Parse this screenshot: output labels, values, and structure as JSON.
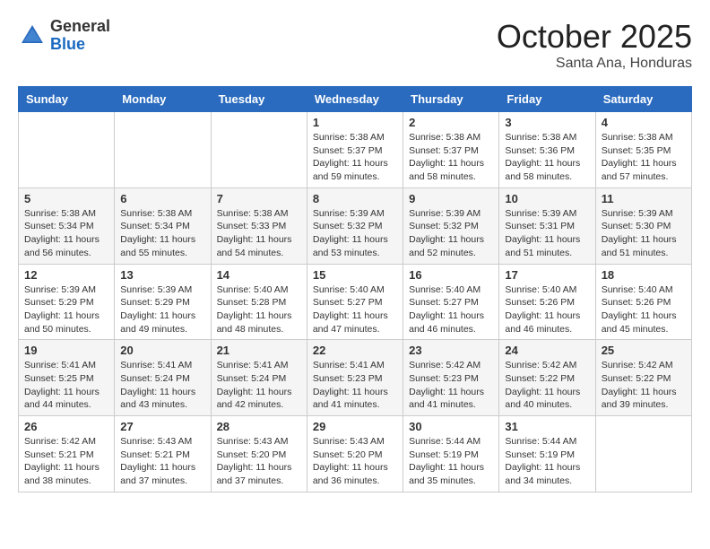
{
  "header": {
    "logo_general": "General",
    "logo_blue": "Blue",
    "month_title": "October 2025",
    "subtitle": "Santa Ana, Honduras"
  },
  "days_of_week": [
    "Sunday",
    "Monday",
    "Tuesday",
    "Wednesday",
    "Thursday",
    "Friday",
    "Saturday"
  ],
  "weeks": [
    [
      {
        "day": "",
        "info": ""
      },
      {
        "day": "",
        "info": ""
      },
      {
        "day": "",
        "info": ""
      },
      {
        "day": "1",
        "info": "Sunrise: 5:38 AM\nSunset: 5:37 PM\nDaylight: 11 hours\nand 59 minutes."
      },
      {
        "day": "2",
        "info": "Sunrise: 5:38 AM\nSunset: 5:37 PM\nDaylight: 11 hours\nand 58 minutes."
      },
      {
        "day": "3",
        "info": "Sunrise: 5:38 AM\nSunset: 5:36 PM\nDaylight: 11 hours\nand 58 minutes."
      },
      {
        "day": "4",
        "info": "Sunrise: 5:38 AM\nSunset: 5:35 PM\nDaylight: 11 hours\nand 57 minutes."
      }
    ],
    [
      {
        "day": "5",
        "info": "Sunrise: 5:38 AM\nSunset: 5:34 PM\nDaylight: 11 hours\nand 56 minutes."
      },
      {
        "day": "6",
        "info": "Sunrise: 5:38 AM\nSunset: 5:34 PM\nDaylight: 11 hours\nand 55 minutes."
      },
      {
        "day": "7",
        "info": "Sunrise: 5:38 AM\nSunset: 5:33 PM\nDaylight: 11 hours\nand 54 minutes."
      },
      {
        "day": "8",
        "info": "Sunrise: 5:39 AM\nSunset: 5:32 PM\nDaylight: 11 hours\nand 53 minutes."
      },
      {
        "day": "9",
        "info": "Sunrise: 5:39 AM\nSunset: 5:32 PM\nDaylight: 11 hours\nand 52 minutes."
      },
      {
        "day": "10",
        "info": "Sunrise: 5:39 AM\nSunset: 5:31 PM\nDaylight: 11 hours\nand 51 minutes."
      },
      {
        "day": "11",
        "info": "Sunrise: 5:39 AM\nSunset: 5:30 PM\nDaylight: 11 hours\nand 51 minutes."
      }
    ],
    [
      {
        "day": "12",
        "info": "Sunrise: 5:39 AM\nSunset: 5:29 PM\nDaylight: 11 hours\nand 50 minutes."
      },
      {
        "day": "13",
        "info": "Sunrise: 5:39 AM\nSunset: 5:29 PM\nDaylight: 11 hours\nand 49 minutes."
      },
      {
        "day": "14",
        "info": "Sunrise: 5:40 AM\nSunset: 5:28 PM\nDaylight: 11 hours\nand 48 minutes."
      },
      {
        "day": "15",
        "info": "Sunrise: 5:40 AM\nSunset: 5:27 PM\nDaylight: 11 hours\nand 47 minutes."
      },
      {
        "day": "16",
        "info": "Sunrise: 5:40 AM\nSunset: 5:27 PM\nDaylight: 11 hours\nand 46 minutes."
      },
      {
        "day": "17",
        "info": "Sunrise: 5:40 AM\nSunset: 5:26 PM\nDaylight: 11 hours\nand 46 minutes."
      },
      {
        "day": "18",
        "info": "Sunrise: 5:40 AM\nSunset: 5:26 PM\nDaylight: 11 hours\nand 45 minutes."
      }
    ],
    [
      {
        "day": "19",
        "info": "Sunrise: 5:41 AM\nSunset: 5:25 PM\nDaylight: 11 hours\nand 44 minutes."
      },
      {
        "day": "20",
        "info": "Sunrise: 5:41 AM\nSunset: 5:24 PM\nDaylight: 11 hours\nand 43 minutes."
      },
      {
        "day": "21",
        "info": "Sunrise: 5:41 AM\nSunset: 5:24 PM\nDaylight: 11 hours\nand 42 minutes."
      },
      {
        "day": "22",
        "info": "Sunrise: 5:41 AM\nSunset: 5:23 PM\nDaylight: 11 hours\nand 41 minutes."
      },
      {
        "day": "23",
        "info": "Sunrise: 5:42 AM\nSunset: 5:23 PM\nDaylight: 11 hours\nand 41 minutes."
      },
      {
        "day": "24",
        "info": "Sunrise: 5:42 AM\nSunset: 5:22 PM\nDaylight: 11 hours\nand 40 minutes."
      },
      {
        "day": "25",
        "info": "Sunrise: 5:42 AM\nSunset: 5:22 PM\nDaylight: 11 hours\nand 39 minutes."
      }
    ],
    [
      {
        "day": "26",
        "info": "Sunrise: 5:42 AM\nSunset: 5:21 PM\nDaylight: 11 hours\nand 38 minutes."
      },
      {
        "day": "27",
        "info": "Sunrise: 5:43 AM\nSunset: 5:21 PM\nDaylight: 11 hours\nand 37 minutes."
      },
      {
        "day": "28",
        "info": "Sunrise: 5:43 AM\nSunset: 5:20 PM\nDaylight: 11 hours\nand 37 minutes."
      },
      {
        "day": "29",
        "info": "Sunrise: 5:43 AM\nSunset: 5:20 PM\nDaylight: 11 hours\nand 36 minutes."
      },
      {
        "day": "30",
        "info": "Sunrise: 5:44 AM\nSunset: 5:19 PM\nDaylight: 11 hours\nand 35 minutes."
      },
      {
        "day": "31",
        "info": "Sunrise: 5:44 AM\nSunset: 5:19 PM\nDaylight: 11 hours\nand 34 minutes."
      },
      {
        "day": "",
        "info": ""
      }
    ]
  ]
}
